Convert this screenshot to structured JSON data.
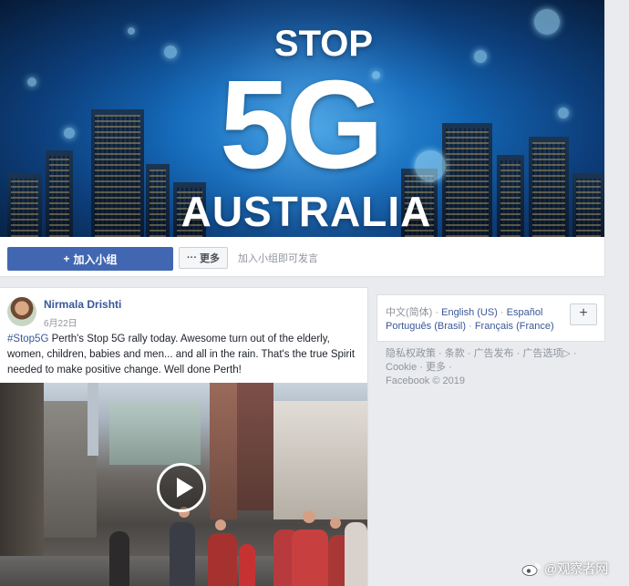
{
  "group": {
    "cover": {
      "line1": "STOP",
      "line2": "5G",
      "line3": "AUSTRALIA"
    },
    "join_label": "加入小组",
    "more_label": "更多",
    "join_hint": "加入小组即可发言"
  },
  "post": {
    "author": "Nirmala Drishti",
    "date": "6月22日",
    "hashtag": "#Stop5G",
    "text": " Perth's Stop 5G rally today. Awesome turn out of the elderly, women, children, babies and men... and all in the rain. That's the true Spirit needed to make positive change. Well done Perth!"
  },
  "languages": {
    "current": "中文(简体)",
    "items": [
      "English (US)",
      "Español",
      "Português (Brasil)",
      "Français (France)"
    ],
    "separator": " · "
  },
  "footer": {
    "links": [
      "隐私权政策",
      "条款",
      "广告发布",
      "广告选项",
      "Cookie",
      "更多"
    ],
    "copyright": "Facebook © 2019"
  },
  "watermark": {
    "text": "@观察者网"
  },
  "colors": {
    "fb_blue": "#4267b2",
    "link": "#385898",
    "muted": "#90949c",
    "bg": "#e9ebee"
  }
}
